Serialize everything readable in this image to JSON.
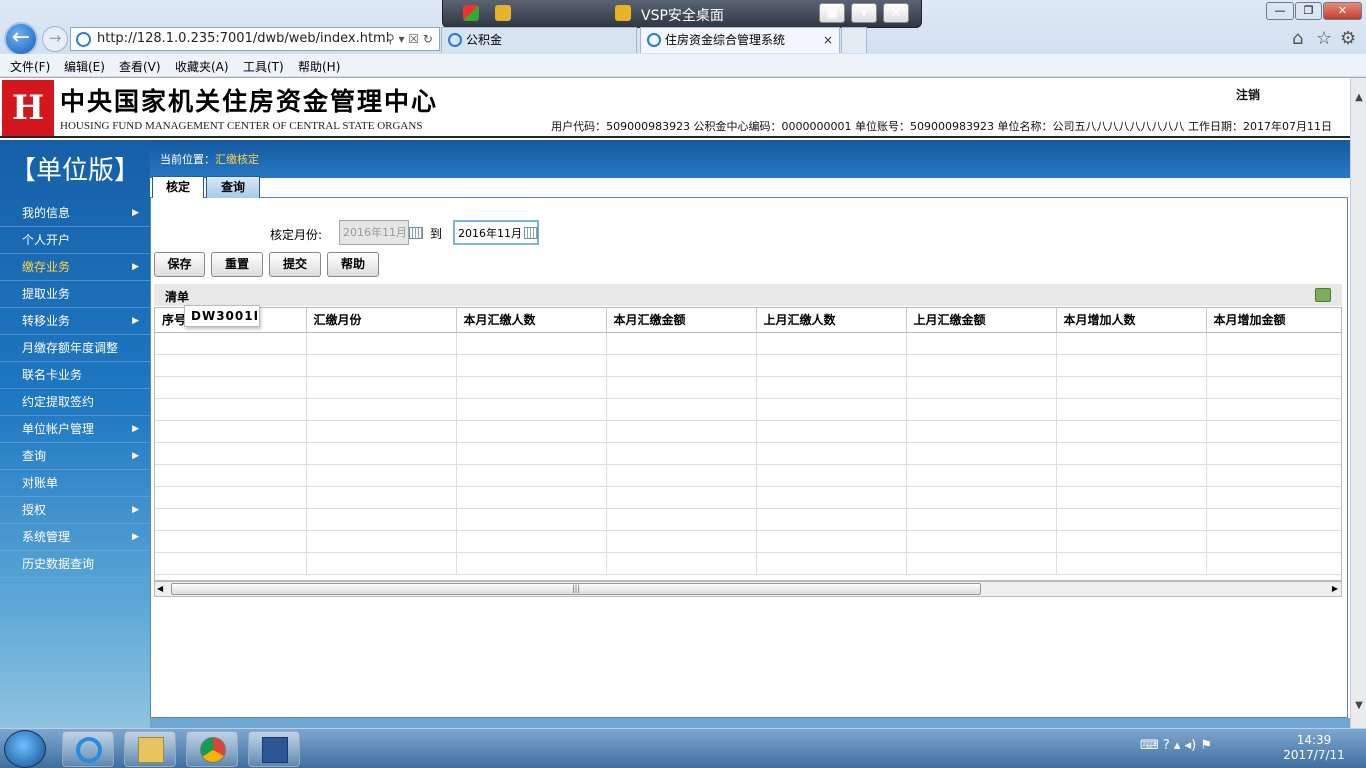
{
  "browser": {
    "url": "http://128.1.0.235:7001/dwb/web/index.html",
    "addr_tools": "⚲ ▾ ☒ ↻",
    "tabs": [
      {
        "label": "公积金"
      },
      {
        "label": "住房资金综合管理系统",
        "close": "×"
      }
    ],
    "vsp_title": "VSP安全桌面",
    "menu": [
      "文件(F)",
      "编辑(E)",
      "查看(V)",
      "收藏夹(A)",
      "工具(T)",
      "帮助(H)"
    ],
    "window_buttons": {
      "min": "—",
      "max": "❐",
      "close": "✕"
    },
    "right_icons": [
      "⌂",
      "☆",
      "⚙"
    ]
  },
  "header": {
    "logo_letter": "H",
    "title_cn": "中央国家机关住房资金管理中心",
    "title_en": "HOUSING FUND MANAGEMENT CENTER OF CENTRAL STATE ORGANS",
    "logout": "注销",
    "user_info": "用户代码：509000983923  公积金中心编码：0000000001  单位账号：509000983923  单位名称：公司五八八八八八八八八八 工作日期：2017年07月11日"
  },
  "sidebar": {
    "edition": "【单位版】",
    "items": [
      {
        "label": "我的信息",
        "arrow": "▶"
      },
      {
        "label": "个人开户",
        "arrow": ""
      },
      {
        "label": "缴存业务",
        "arrow": "▶",
        "active": true
      },
      {
        "label": "提取业务",
        "arrow": ""
      },
      {
        "label": "转移业务",
        "arrow": "▶"
      },
      {
        "label": "月缴存额年度调整",
        "arrow": ""
      },
      {
        "label": "联名卡业务",
        "arrow": ""
      },
      {
        "label": "约定提取签约",
        "arrow": ""
      },
      {
        "label": "单位帐户管理",
        "arrow": "▶"
      },
      {
        "label": "查询",
        "arrow": "▶"
      },
      {
        "label": "对账单",
        "arrow": ""
      },
      {
        "label": "授权",
        "arrow": "▶"
      },
      {
        "label": "系统管理",
        "arrow": "▶"
      },
      {
        "label": "历史数据查询",
        "arrow": ""
      }
    ]
  },
  "main": {
    "breadcrumb_prefix": "当前位置：",
    "breadcrumb_current": "汇缴核定",
    "tabs": [
      "核定",
      "查询"
    ],
    "month_label": "核定月份:",
    "month_from": "2016年11月",
    "to_label": "到",
    "month_to": "2016年11月",
    "buttons": {
      "save": "保存",
      "reset": "重置",
      "submit": "提交",
      "help": "帮助"
    },
    "list_title": "清单",
    "tooltip": "DW3001I",
    "columns": [
      "序号",
      "汇缴月份",
      "本月汇缴人数",
      "本月汇缴金额",
      "上月汇缴人数",
      "上月汇缴金额",
      "本月增加人数",
      "本月增加金额"
    ],
    "empty_rows": 11,
    "scroll_grip": "|||"
  },
  "taskbar": {
    "time": "14:39",
    "date": "2017/7/11",
    "tray": "⌨ ? ▴ ◂) ⚑"
  }
}
